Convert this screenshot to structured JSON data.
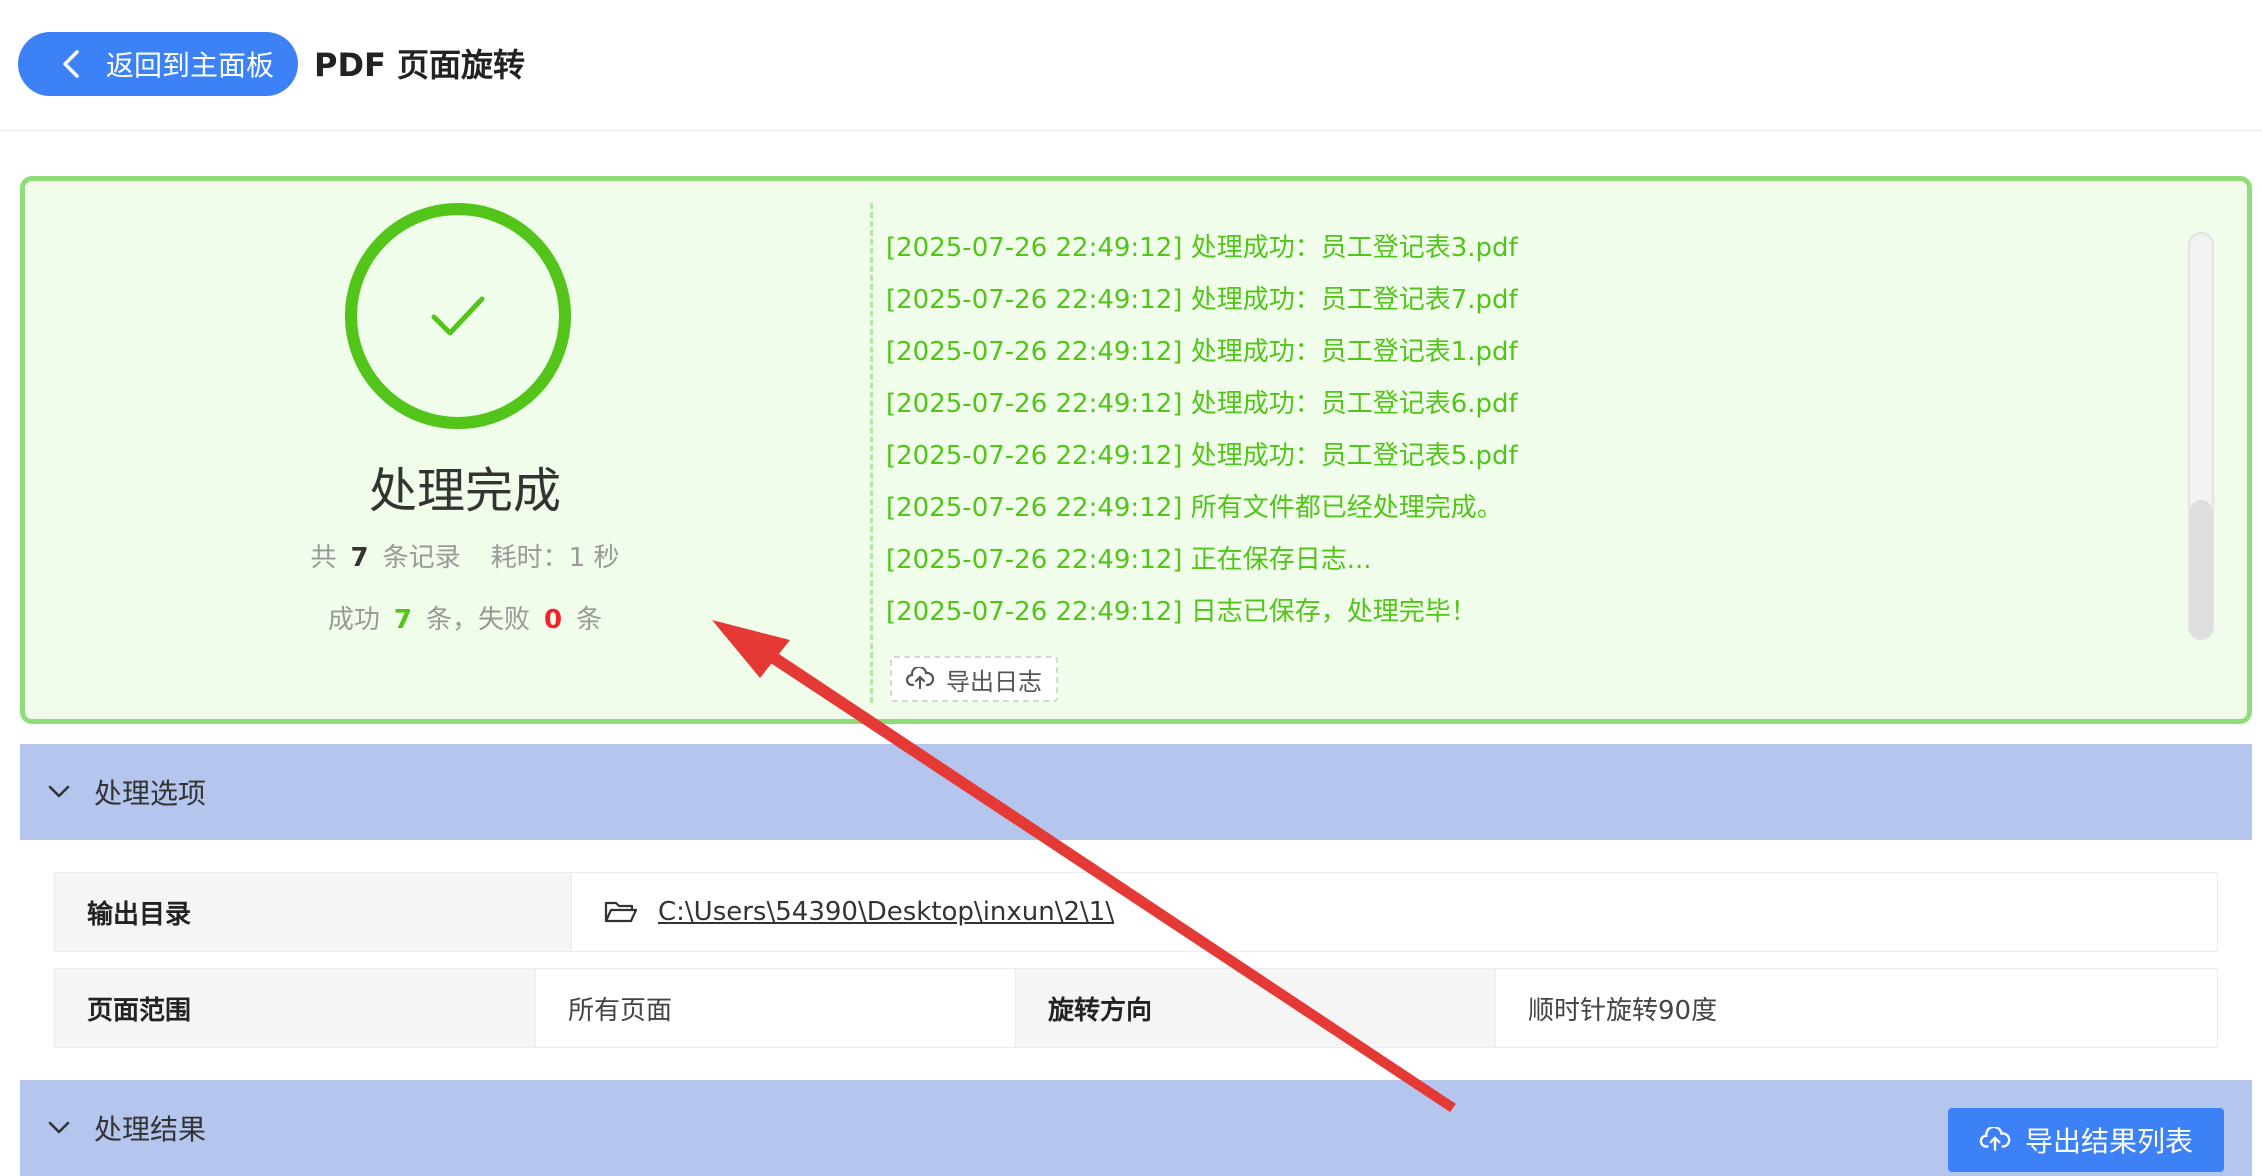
{
  "header": {
    "back_label": "返回到主面板",
    "title": "PDF 页面旋转"
  },
  "result": {
    "status_title": "处理完成",
    "total_prefix": "共",
    "total_count": "7",
    "total_suffix": "条记录",
    "time_label": "耗时：1 秒",
    "success_prefix": "成功",
    "success_count": "7",
    "success_suffix": "条，失败",
    "fail_count": "0",
    "fail_suffix": "条",
    "logs": [
      "[2025-07-26 22:49:12] 处理成功：员工登记表3.pdf",
      "[2025-07-26 22:49:12] 处理成功：员工登记表7.pdf",
      "[2025-07-26 22:49:12] 处理成功：员工登记表1.pdf",
      "[2025-07-26 22:49:12] 处理成功：员工登记表6.pdf",
      "[2025-07-26 22:49:12] 处理成功：员工登记表5.pdf",
      "[2025-07-26 22:49:12] 所有文件都已经处理完成。",
      "[2025-07-26 22:49:12] 正在保存日志...",
      "[2025-07-26 22:49:12] 日志已保存，处理完毕！"
    ],
    "export_log_label": "导出日志"
  },
  "options_section": {
    "title": "处理选项",
    "output_dir_label": "输出目录",
    "output_dir_value": "C:\\Users\\54390\\Desktop\\inxun\\2\\1\\",
    "page_range_label": "页面范围",
    "page_range_value": "所有页面",
    "rotate_dir_label": "旋转方向",
    "rotate_dir_value": "顺时针旋转90度"
  },
  "results_section": {
    "title": "处理结果",
    "export_list_label": "导出结果列表"
  },
  "colors": {
    "accent": "#3c82f6",
    "success": "#52c41a",
    "fail": "#f5222d",
    "section_bar": "#b4c6ee",
    "annotation_arrow": "#e53935"
  },
  "icons": [
    "chevron-left-icon",
    "check-icon",
    "cloud-upload-icon",
    "chevron-down-icon",
    "folder-open-icon"
  ]
}
